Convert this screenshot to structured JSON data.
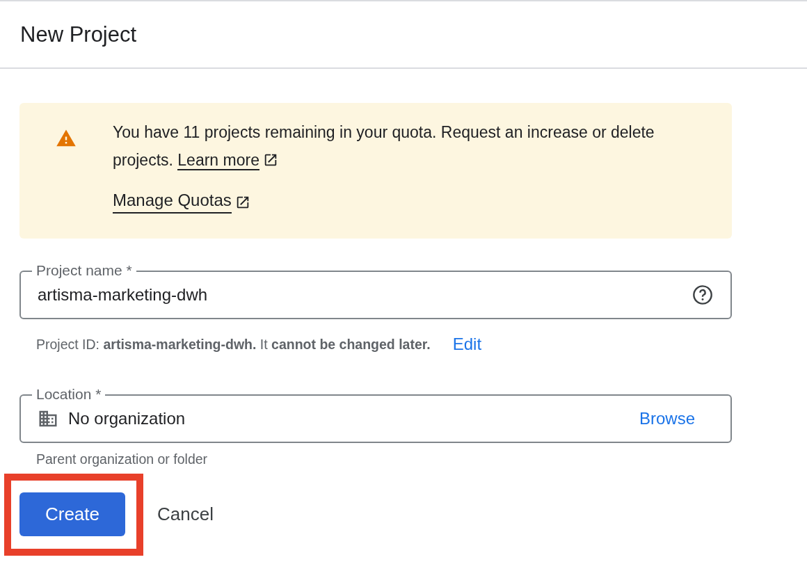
{
  "dialog": {
    "title": "New Project"
  },
  "quota_notice": {
    "message": "You have 11 projects remaining in your quota. Request an increase or delete projects.",
    "learn_more_link": "Learn more",
    "manage_link": "Manage Quotas"
  },
  "project_name_field": {
    "label": "Project name *",
    "value": "artisma-marketing-dwh",
    "helper": "Project ID: **artisma-marketing-dwh.** It **cannot be changed later.**",
    "edit_link": "Edit"
  },
  "location_field": {
    "label": "Location *",
    "value": "No organization",
    "browse_link": "Browse",
    "helper": "Parent organization or folder"
  },
  "buttons": [
    {
      "label": "Create",
      "kind": "primary",
      "highlighted": true
    },
    {
      "label": "Cancel",
      "kind": "text",
      "highlighted": false
    }
  ]
}
